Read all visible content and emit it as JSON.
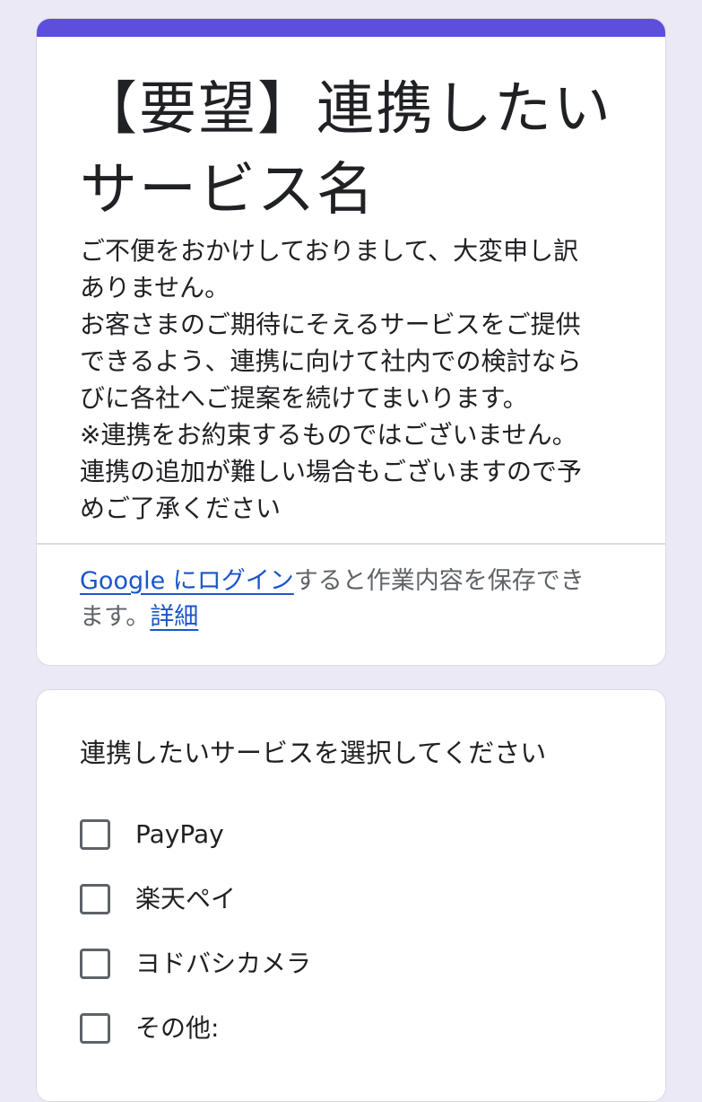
{
  "theme": {
    "accent_color": "#5b4fdc",
    "background_color": "#ece9f7",
    "link_color": "#1a56c9"
  },
  "form": {
    "title_lines": [
      "【要望】連携したい",
      "サービス名"
    ],
    "description_lines": [
      "ご不便をおかけしておりまして、大変申し訳",
      "ありません。",
      "お客さまのご期待にそえるサービスをご提供",
      "できるよう、連携に向けて社内での検討なら",
      "びに各社へご提案を続けてまいります。",
      "※連携をお約束するものではございません。",
      "連携の追加が難しい場合もございますので予",
      "めご了承ください"
    ],
    "login_note": {
      "link_text": "Google にログイン",
      "text_after_link": "すると作業内容を保存でき",
      "line2_text": "ます。",
      "details_link": "詳細"
    }
  },
  "question": {
    "title": "連携したいサービスを選択してください",
    "options": [
      {
        "label": "PayPay",
        "checked": false
      },
      {
        "label": "楽天ペイ",
        "checked": false
      },
      {
        "label": "ヨドバシカメラ",
        "checked": false
      },
      {
        "label": "その他:",
        "checked": false
      }
    ]
  }
}
